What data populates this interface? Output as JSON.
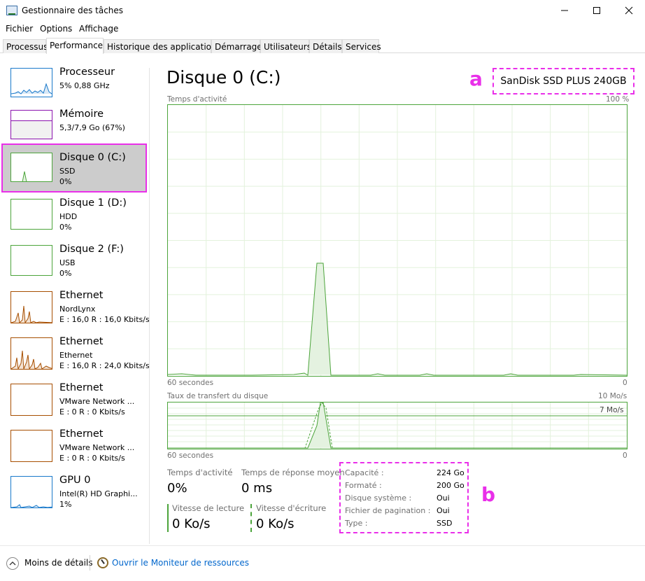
{
  "window": {
    "title": "Gestionnaire des tâches"
  },
  "menu": [
    "Fichier",
    "Options",
    "Affichage"
  ],
  "tabs": [
    {
      "label": "Processus"
    },
    {
      "label": "Performance",
      "active": true
    },
    {
      "label": "Historique des applications"
    },
    {
      "label": "Démarrage"
    },
    {
      "label": "Utilisateurs"
    },
    {
      "label": "Détails"
    },
    {
      "label": "Services"
    }
  ],
  "sidebar": {
    "items": [
      {
        "name": "Processeur",
        "sub": "5% 0,88 GHz",
        "sub2": "",
        "color": "#1979ca"
      },
      {
        "name": "Mémoire",
        "sub": "5,3/7,9 Go (67%)",
        "sub2": "",
        "color": "#8b12ae"
      },
      {
        "name": "Disque 0 (C:)",
        "sub": "SSD",
        "sub2": "0%",
        "color": "#4ca43b",
        "selected": true
      },
      {
        "name": "Disque 1 (D:)",
        "sub": "HDD",
        "sub2": "0%",
        "color": "#4ca43b"
      },
      {
        "name": "Disque 2 (F:)",
        "sub": "USB",
        "sub2": "0%",
        "color": "#4ca43b"
      },
      {
        "name": "Ethernet",
        "sub": "NordLynx",
        "sub2": "E : 16,0  R : 16,0 Kbits/s",
        "color": "#a74f01"
      },
      {
        "name": "Ethernet",
        "sub": "Ethernet",
        "sub2": "E : 16,0  R : 24,0 Kbits/s",
        "color": "#a74f01"
      },
      {
        "name": "Ethernet",
        "sub": "VMware Network ...",
        "sub2": "E : 0  R : 0 Kbits/s",
        "color": "#a74f01"
      },
      {
        "name": "Ethernet",
        "sub": "VMware Network ...",
        "sub2": "E : 0  R : 0 Kbits/s",
        "color": "#a74f01"
      },
      {
        "name": "GPU 0",
        "sub": "Intel(R) HD Graphi...",
        "sub2": "1%",
        "color": "#1979ca"
      }
    ]
  },
  "main": {
    "title": "Disque 0 (C:)",
    "model": "SanDisk SSD PLUS 240GB",
    "annotation_a": "a",
    "annotation_b": "b",
    "activity_graph": {
      "label": "Temps d'activité",
      "max_label": "100 %",
      "time_label": "60 secondes",
      "min_label": "0"
    },
    "transfer_graph": {
      "label": "Taux de transfert du disque",
      "max_label": "10 Mo/s",
      "line_label": "7 Mo/s",
      "time_label": "60 secondes",
      "min_label": "0"
    },
    "stats": {
      "activity_label": "Temps d'activité",
      "activity_value": "0%",
      "response_label": "Temps de réponse moyen",
      "response_value": "0 ms",
      "read_label": "Vitesse de lecture",
      "read_value": "0 Ko/s",
      "write_label": "Vitesse d'écriture",
      "write_value": "0 Ko/s"
    },
    "properties": [
      {
        "key": "Capacité :",
        "value": "224 Go"
      },
      {
        "key": "Formaté :",
        "value": "200 Go"
      },
      {
        "key": "Disque système :",
        "value": "Oui"
      },
      {
        "key": "Fichier de pagination :",
        "value": "Oui"
      },
      {
        "key": "Type :",
        "value": "SSD"
      }
    ]
  },
  "footer": {
    "less_details": "Moins de détails",
    "resource_monitor": "Ouvrir le Moniteur de ressources"
  },
  "accent": "#4ca43b",
  "highlight": "#e92fe9"
}
